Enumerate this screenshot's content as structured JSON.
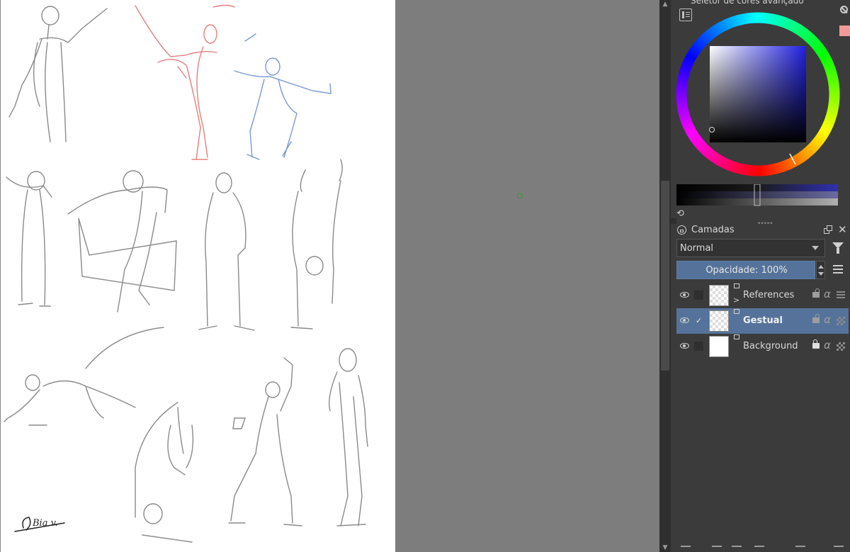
{
  "colors": {
    "canvas_bg": "#7d7d7d",
    "paper": "#ffffff",
    "panel_bg": "#3b3b3b",
    "selection": "#55739a",
    "foreground_color": "#f19a9a"
  },
  "color_selector": {
    "title": "Seletor de cores avançado"
  },
  "layers_panel": {
    "title": "Camadas",
    "blend_mode": "Normal",
    "opacity_label": "Opacidade:  100%",
    "layers": [
      {
        "name": "References",
        "type": "group",
        "visible": true,
        "selected": false,
        "locked": false
      },
      {
        "name": "Gestual",
        "type": "paint",
        "visible": true,
        "selected": true,
        "locked": false
      },
      {
        "name": "Background",
        "type": "paint",
        "visible": true,
        "selected": false,
        "locked": true
      }
    ]
  },
  "signature": "Bia v."
}
